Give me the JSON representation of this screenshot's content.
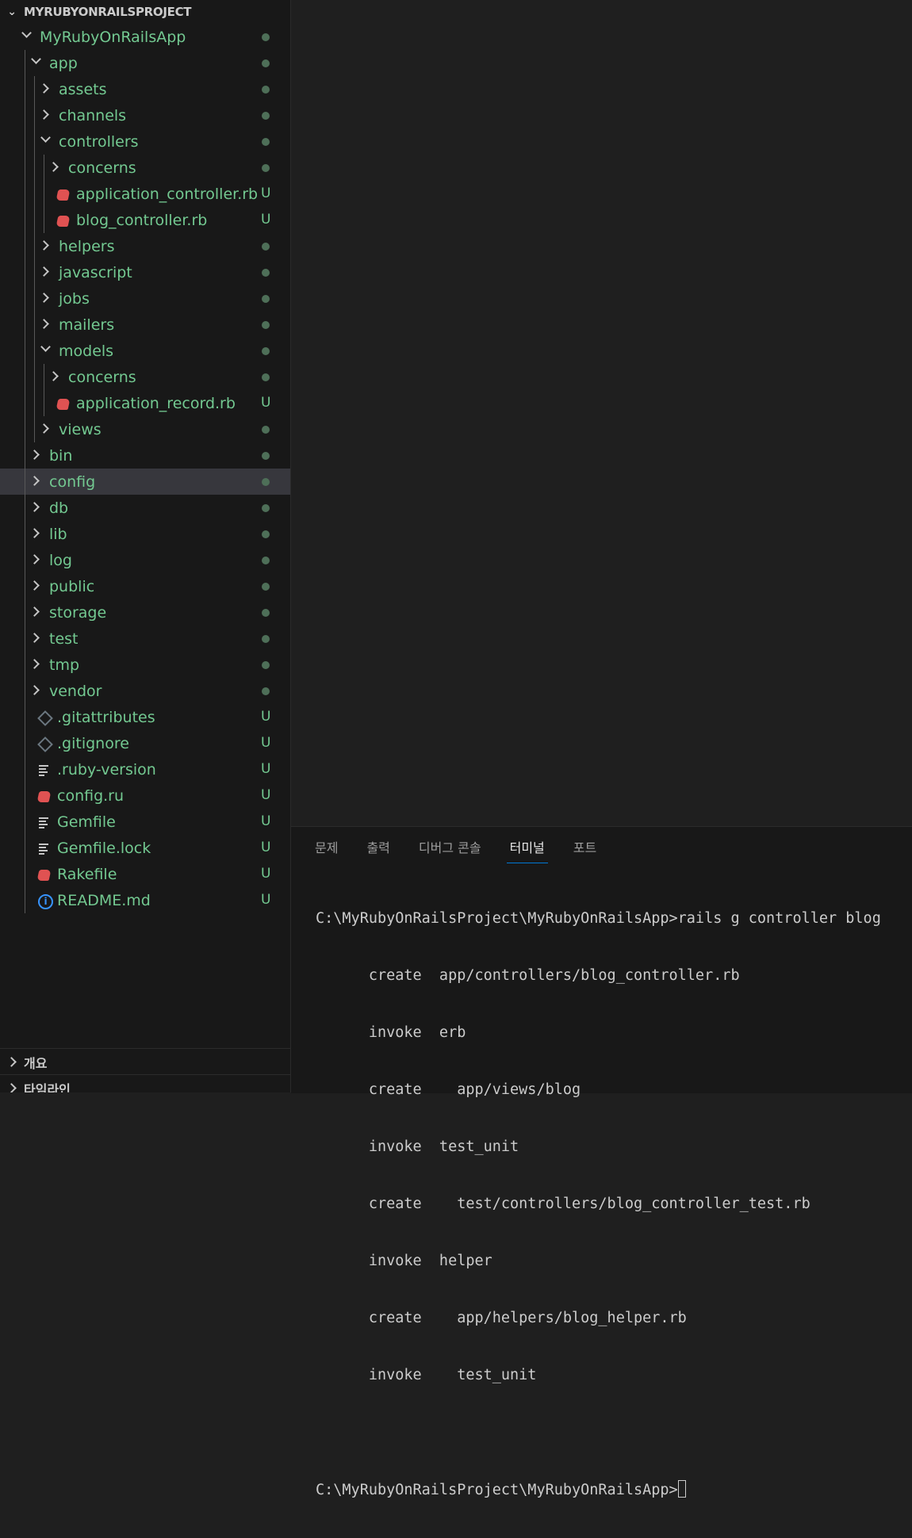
{
  "explorer": {
    "project_title": "MYRUBYONRAILSPROJECT",
    "items": [
      {
        "label": "MyRubyOnRailsApp",
        "depth": 0,
        "kind": "folder-open",
        "status": "dot",
        "name": "tree-folder-myrubyonrailsapp"
      },
      {
        "label": "app",
        "depth": 1,
        "kind": "folder-open",
        "status": "dot",
        "name": "tree-folder-app"
      },
      {
        "label": "assets",
        "depth": 2,
        "kind": "folder",
        "status": "dot",
        "name": "tree-folder-assets"
      },
      {
        "label": "channels",
        "depth": 2,
        "kind": "folder",
        "status": "dot",
        "name": "tree-folder-channels"
      },
      {
        "label": "controllers",
        "depth": 2,
        "kind": "folder-open",
        "status": "dot",
        "name": "tree-folder-controllers"
      },
      {
        "label": "concerns",
        "depth": 3,
        "kind": "folder",
        "status": "dot",
        "name": "tree-folder-controllers-concerns"
      },
      {
        "label": "application_controller.rb",
        "depth": 3,
        "kind": "ruby",
        "status": "U",
        "name": "tree-file-application-controller"
      },
      {
        "label": "blog_controller.rb",
        "depth": 3,
        "kind": "ruby",
        "status": "U",
        "name": "tree-file-blog-controller"
      },
      {
        "label": "helpers",
        "depth": 2,
        "kind": "folder",
        "status": "dot",
        "name": "tree-folder-helpers"
      },
      {
        "label": "javascript",
        "depth": 2,
        "kind": "folder",
        "status": "dot",
        "name": "tree-folder-javascript"
      },
      {
        "label": "jobs",
        "depth": 2,
        "kind": "folder",
        "status": "dot",
        "name": "tree-folder-jobs"
      },
      {
        "label": "mailers",
        "depth": 2,
        "kind": "folder",
        "status": "dot",
        "name": "tree-folder-mailers"
      },
      {
        "label": "models",
        "depth": 2,
        "kind": "folder-open",
        "status": "dot",
        "name": "tree-folder-models"
      },
      {
        "label": "concerns",
        "depth": 3,
        "kind": "folder",
        "status": "dot",
        "name": "tree-folder-models-concerns"
      },
      {
        "label": "application_record.rb",
        "depth": 3,
        "kind": "ruby",
        "status": "U",
        "name": "tree-file-application-record"
      },
      {
        "label": "views",
        "depth": 2,
        "kind": "folder",
        "status": "dot",
        "name": "tree-folder-views"
      },
      {
        "label": "bin",
        "depth": 1,
        "kind": "folder",
        "status": "dot",
        "name": "tree-folder-bin"
      },
      {
        "label": "config",
        "depth": 1,
        "kind": "folder",
        "status": "dot",
        "name": "tree-folder-config",
        "selected": true
      },
      {
        "label": "db",
        "depth": 1,
        "kind": "folder",
        "status": "dot",
        "name": "tree-folder-db"
      },
      {
        "label": "lib",
        "depth": 1,
        "kind": "folder",
        "status": "dot",
        "name": "tree-folder-lib"
      },
      {
        "label": "log",
        "depth": 1,
        "kind": "folder",
        "status": "dot",
        "name": "tree-folder-log"
      },
      {
        "label": "public",
        "depth": 1,
        "kind": "folder",
        "status": "dot",
        "name": "tree-folder-public"
      },
      {
        "label": "storage",
        "depth": 1,
        "kind": "folder",
        "status": "dot",
        "name": "tree-folder-storage"
      },
      {
        "label": "test",
        "depth": 1,
        "kind": "folder",
        "status": "dot",
        "name": "tree-folder-test"
      },
      {
        "label": "tmp",
        "depth": 1,
        "kind": "folder",
        "status": "dot",
        "name": "tree-folder-tmp"
      },
      {
        "label": "vendor",
        "depth": 1,
        "kind": "folder",
        "status": "dot",
        "name": "tree-folder-vendor"
      },
      {
        "label": ".gitattributes",
        "depth": 1,
        "kind": "git",
        "status": "U",
        "name": "tree-file-gitattributes"
      },
      {
        "label": ".gitignore",
        "depth": 1,
        "kind": "git",
        "status": "U",
        "name": "tree-file-gitignore"
      },
      {
        "label": ".ruby-version",
        "depth": 1,
        "kind": "lines",
        "status": "U",
        "name": "tree-file-ruby-version"
      },
      {
        "label": "config.ru",
        "depth": 1,
        "kind": "ruby",
        "status": "U",
        "name": "tree-file-config-ru"
      },
      {
        "label": "Gemfile",
        "depth": 1,
        "kind": "lines",
        "status": "U",
        "name": "tree-file-gemfile"
      },
      {
        "label": "Gemfile.lock",
        "depth": 1,
        "kind": "lines",
        "status": "U",
        "name": "tree-file-gemfile-lock"
      },
      {
        "label": "Rakefile",
        "depth": 1,
        "kind": "ruby",
        "status": "U",
        "name": "tree-file-rakefile"
      },
      {
        "label": "README.md",
        "depth": 1,
        "kind": "info",
        "status": "U",
        "name": "tree-file-readme"
      }
    ]
  },
  "bottom_sections": {
    "outline": "개요",
    "timeline": "타임라인"
  },
  "panel": {
    "tabs": [
      "문제",
      "출력",
      "디버그 콘솔",
      "터미널",
      "포트"
    ],
    "active_tab": "터미널",
    "terminal_lines": [
      "C:\\MyRubyOnRailsProject\\MyRubyOnRailsApp>rails g controller blog",
      "      create  app/controllers/blog_controller.rb",
      "      invoke  erb",
      "      create    app/views/blog",
      "      invoke  test_unit",
      "      create    test/controllers/blog_controller_test.rb",
      "      invoke  helper",
      "      create    app/helpers/blog_helper.rb",
      "      invoke    test_unit",
      "",
      "C:\\MyRubyOnRailsProject\\MyRubyOnRailsApp>"
    ]
  },
  "colors": {
    "untracked": "#73c991",
    "ruby_icon": "#e05252",
    "accent": "#0078d4"
  }
}
